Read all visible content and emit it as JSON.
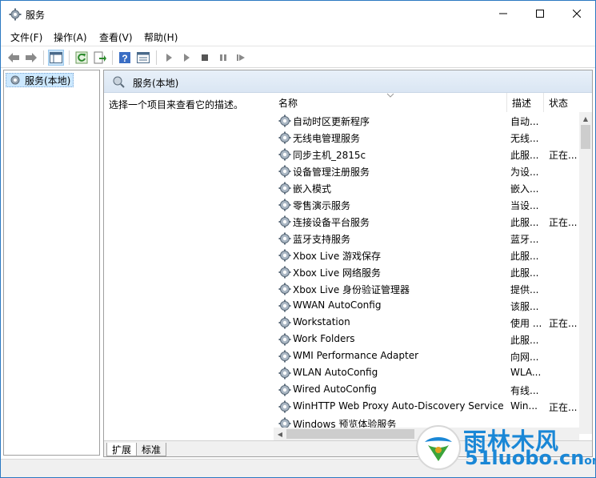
{
  "window": {
    "title": "服务",
    "icon": "gear-icon"
  },
  "menu": {
    "items": [
      "文件(F)",
      "操作(A)",
      "查看(V)",
      "帮助(H)"
    ]
  },
  "toolbar": {
    "icons": [
      "back-arrow-icon",
      "forward-arrow-icon",
      "show-hide-tree-icon",
      "refresh-icon",
      "export-list-icon",
      "help-icon",
      "properties-icon",
      "start-service-icon",
      "start-service-alt-icon",
      "stop-service-icon",
      "pause-service-icon",
      "restart-service-icon"
    ]
  },
  "tree": {
    "item_label": "服务(本地)"
  },
  "pane": {
    "title": "服务(本地)",
    "description_prompt": "选择一个项目来查看它的描述。"
  },
  "list": {
    "columns": [
      "名称",
      "描述",
      "状态"
    ],
    "rows": [
      {
        "name": "自动时区更新程序",
        "desc": "自动...",
        "status": ""
      },
      {
        "name": "无线电管理服务",
        "desc": "无线...",
        "status": ""
      },
      {
        "name": "同步主机_2815c",
        "desc": "此服...",
        "status": "正在..."
      },
      {
        "name": "设备管理注册服务",
        "desc": "为设...",
        "status": ""
      },
      {
        "name": "嵌入模式",
        "desc": "嵌入...",
        "status": ""
      },
      {
        "name": "零售演示服务",
        "desc": "当设...",
        "status": ""
      },
      {
        "name": "连接设备平台服务",
        "desc": "此服...",
        "status": "正在..."
      },
      {
        "name": "蓝牙支持服务",
        "desc": "蓝牙...",
        "status": ""
      },
      {
        "name": "Xbox Live 游戏保存",
        "desc": "此服...",
        "status": ""
      },
      {
        "name": "Xbox Live 网络服务",
        "desc": "此服...",
        "status": ""
      },
      {
        "name": "Xbox Live 身份验证管理器",
        "desc": "提供...",
        "status": ""
      },
      {
        "name": "WWAN AutoConfig",
        "desc": "该服...",
        "status": ""
      },
      {
        "name": "Workstation",
        "desc": "使用 ...",
        "status": "正在..."
      },
      {
        "name": "Work Folders",
        "desc": "此服...",
        "status": ""
      },
      {
        "name": "WMI Performance Adapter",
        "desc": "向网...",
        "status": ""
      },
      {
        "name": "WLAN AutoConfig",
        "desc": "WLA...",
        "status": ""
      },
      {
        "name": "Wired AutoConfig",
        "desc": "有线...",
        "status": ""
      },
      {
        "name": "WinHTTP Web Proxy Auto-Discovery Service",
        "desc": "Win...",
        "status": "正在..."
      },
      {
        "name": "Windows 预览体验服务",
        "desc": "",
        "status": ""
      }
    ]
  },
  "tabs": {
    "items": [
      "扩展",
      "标准"
    ],
    "active": "扩展"
  },
  "watermark": {
    "brand": "雨林木风",
    "url": "51luobo.cn",
    "url_suffix": "om"
  }
}
